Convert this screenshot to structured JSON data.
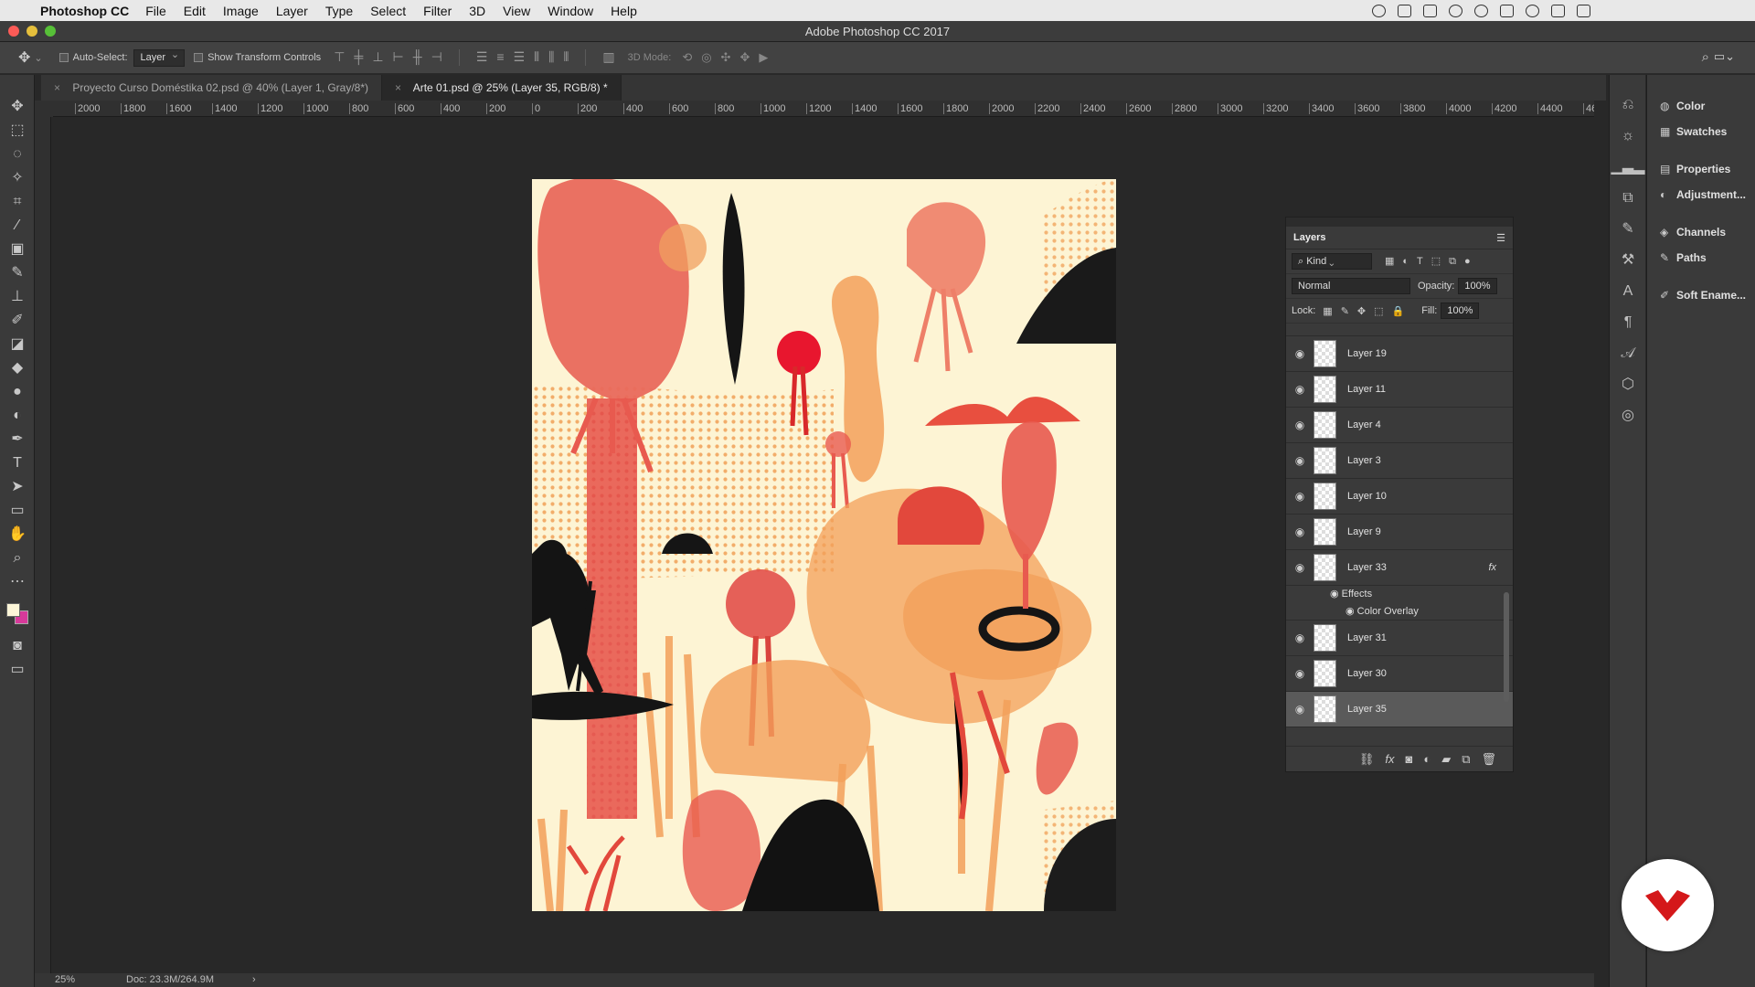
{
  "menubar": {
    "app": "Photoshop CC",
    "items": [
      "File",
      "Edit",
      "Image",
      "Layer",
      "Type",
      "Select",
      "Filter",
      "3D",
      "View",
      "Window",
      "Help"
    ]
  },
  "window": {
    "title": "Adobe Photoshop CC 2017"
  },
  "options": {
    "auto_select_label": "Auto-Select:",
    "auto_select_value": "Layer",
    "transform_label": "Show Transform Controls",
    "mode_3d_label": "3D Mode:"
  },
  "tabs": [
    {
      "label": "Proyecto Curso Doméstika 02.psd @ 40% (Layer 1, Gray/8*)"
    },
    {
      "label": "Arte 01.psd @ 25% (Layer 35, RGB/8) *"
    }
  ],
  "ruler": {
    "ticks": [
      "2000",
      "1800",
      "1600",
      "1400",
      "1200",
      "1000",
      "800",
      "600",
      "400",
      "200",
      "0",
      "200",
      "400",
      "600",
      "800",
      "1000",
      "1200",
      "1400",
      "1600",
      "1800",
      "2000",
      "2200",
      "2400",
      "2600",
      "2800",
      "3000",
      "3200",
      "3400",
      "3600",
      "3800",
      "4000",
      "4200",
      "4400",
      "46"
    ]
  },
  "status": {
    "zoom": "25%",
    "doc": "Doc: 23.3M/264.9M",
    "arrow": "›"
  },
  "right_panels": [
    {
      "label": "Color",
      "icon": "color-wheel-icon"
    },
    {
      "label": "Swatches",
      "icon": "grid-icon"
    },
    {
      "label": "Properties",
      "icon": "properties-icon"
    },
    {
      "label": "Adjustment...",
      "icon": "adjustment-icon"
    },
    {
      "label": "Channels",
      "icon": "channels-icon"
    },
    {
      "label": "Paths",
      "icon": "paths-icon"
    },
    {
      "label": "Soft Ename...",
      "icon": "brush-icon"
    }
  ],
  "layers_panel": {
    "title": "Layers",
    "filter_kind": "Kind",
    "blend_mode": "Normal",
    "opacity_label": "Opacity:",
    "opacity_value": "100%",
    "lock_label": "Lock:",
    "fill_label": "Fill:",
    "fill_value": "100%",
    "layers": [
      {
        "name": "Layer 19"
      },
      {
        "name": "Layer 11"
      },
      {
        "name": "Layer 4"
      },
      {
        "name": "Layer 3"
      },
      {
        "name": "Layer 10"
      },
      {
        "name": "Layer 9"
      },
      {
        "name": "Layer 33",
        "fx": "fx"
      },
      {
        "name": "Layer 31"
      },
      {
        "name": "Layer 30"
      },
      {
        "name": "Layer 35"
      }
    ],
    "effects_label": "Effects",
    "effect_item": "Color Overlay"
  },
  "colors": {
    "accent_red": "#e85a4f",
    "orange": "#f3a260",
    "cream": "#fdf4d4",
    "logo_red": "#d4181a"
  }
}
